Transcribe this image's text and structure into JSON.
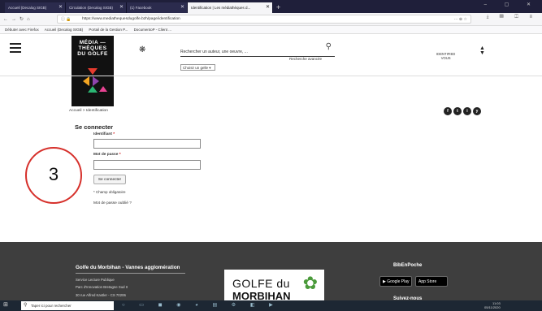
{
  "browser": {
    "tabs": [
      {
        "label": "Accueil (Decalog SIGB)",
        "active": false
      },
      {
        "label": "Circulation (Decalog SIGB)",
        "active": false
      },
      {
        "label": "(1) Facebook",
        "active": false
      },
      {
        "label": "Identification | Les médiathèques d...",
        "active": true
      }
    ],
    "new_tab": "+",
    "url": "https://www.mediathequesdugolfe.bzh/page/identification",
    "url_menu": "··· ⊕ ☆",
    "bookmarks": [
      "Débuter avec Firefox",
      "Accueil (Decalog SIGB)",
      "Portail de la Gestion P...",
      "DocumentoP - Client ..."
    ]
  },
  "header": {
    "logo_text": [
      "MÉDIA —",
      "THÈQUES",
      "DU GOLFE"
    ],
    "search_placeholder": "Rechercher un auteur, une oeuvre, ...",
    "advanced_search": "Recherche avancée",
    "select_value": "Choisir un gelle",
    "account_lines": [
      "IDENTIFIED",
      "VOUS"
    ]
  },
  "content": {
    "breadcrumb": "Accueil > Identification",
    "title": "Se connecter",
    "identifier_label": "Identifiant",
    "password_label": "Mot de passe",
    "required_mark": "*",
    "submit_label": "Se connecter",
    "required_note": "* Champ obligatoire",
    "forgot_link": "Mot de passe oublié ?",
    "annotation_number": "3"
  },
  "social": [
    "f",
    "t",
    "i",
    "y"
  ],
  "footer": {
    "title": "Golfe du Morbihan - Vannes agglomération",
    "address": [
      "Service Lecture Publique",
      "Parc d'Innovation Bretagne Sud II",
      "30 rue Alfred Kastler - CS 70206"
    ],
    "golfe_logo_line1": "GOLFE du",
    "golfe_logo_line2": "MORBIHAN",
    "app_title": "BibEnPoche",
    "google_play": "Google Play",
    "app_store": "App Store",
    "follow": "Suivez-nous"
  },
  "taskbar": {
    "search_placeholder": "Taper ici pour rechercher",
    "time": "11:03",
    "date": "05/11/2020"
  },
  "colors": {
    "annotation": "#d6302b",
    "footer_bg": "#3e3e3e",
    "taskbar_bg": "#1d2733"
  }
}
